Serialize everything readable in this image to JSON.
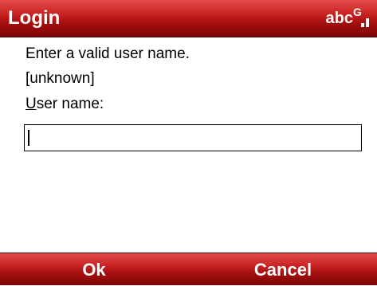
{
  "title_bar": {
    "title": "Login",
    "input_mode": "abc",
    "signal_label": "G"
  },
  "dialog": {
    "message": "Enter a valid user name.",
    "current_value": "[unknown]",
    "field_label": "User name:",
    "field_value": ""
  },
  "softkeys": {
    "left": "Ok",
    "right": "Cancel"
  },
  "colors": {
    "bar_red_top": "#e44a48",
    "bar_red_mid": "#a50f0f",
    "bar_red_bottom": "#7d0505",
    "text_white": "#ffffff",
    "text_black": "#000000"
  }
}
